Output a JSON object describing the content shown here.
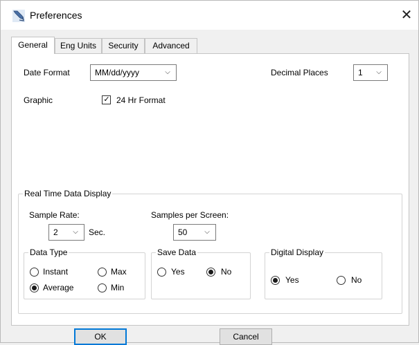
{
  "window": {
    "title": "Preferences",
    "close_glyph": "✕"
  },
  "tabs": [
    {
      "label": "General",
      "active": true
    },
    {
      "label": "Eng Units",
      "active": false
    },
    {
      "label": "Security",
      "active": false
    },
    {
      "label": "Advanced",
      "active": false
    }
  ],
  "general": {
    "date_format_label": "Date Format",
    "date_format_value": "MM/dd/yyyy",
    "decimal_places_label": "Decimal Places",
    "decimal_places_value": "1",
    "graphic_label": "Graphic",
    "hr24_label": "24 Hr Format",
    "hr24_checked": true
  },
  "realtime": {
    "title": "Real Time Data Display",
    "sample_rate_label": "Sample Rate:",
    "sample_rate_value": "2",
    "sample_rate_unit": "Sec.",
    "samples_per_screen_label": "Samples per Screen:",
    "samples_per_screen_value": "50",
    "data_type": {
      "title": "Data Type",
      "instant": "Instant",
      "max": "Max",
      "average": "Average",
      "min": "Min",
      "selected": "average"
    },
    "save_data": {
      "title": "Save Data",
      "yes": "Yes",
      "no": "No",
      "selected": "no"
    },
    "digital_display": {
      "title": "Digital Display",
      "yes": "Yes",
      "no": "No",
      "selected": "yes"
    }
  },
  "buttons": {
    "ok": "OK",
    "cancel": "Cancel"
  },
  "icons": {
    "dropdown": "chevron-down-icon",
    "app": "preferences-wrench-icon"
  },
  "colors": {
    "focus_border": "#0078d7",
    "panel_bg": "#ffffff",
    "dialog_bg": "#f0f0f0"
  }
}
